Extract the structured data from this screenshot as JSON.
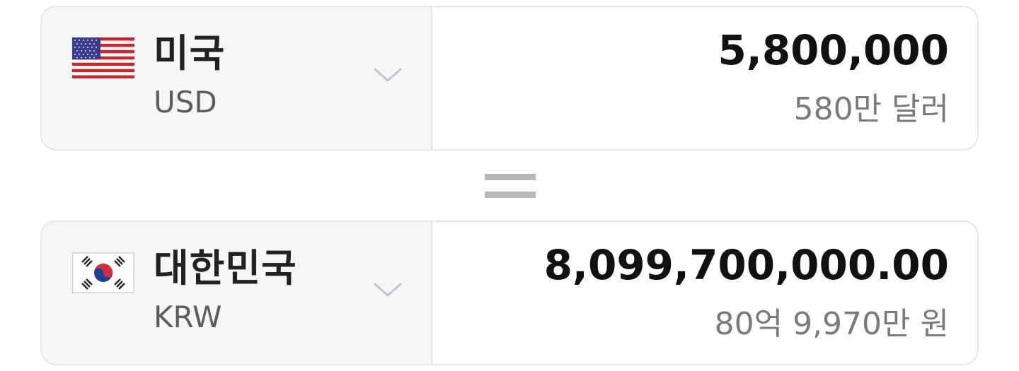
{
  "from_currency": {
    "country": "미국",
    "code": "USD",
    "flag_icon": "us-flag-icon",
    "amount": "5,800,000",
    "amount_words": "580만 달러"
  },
  "to_currency": {
    "country": "대한민국",
    "code": "KRW",
    "flag_icon": "kr-flag-icon",
    "amount": "8,099,700,000.00",
    "amount_words": "80억 9,970만 원"
  },
  "equals_icon": "equals-icon",
  "dropdown_icon": "chevron-down-icon",
  "colors": {
    "panel_bg": "#f6f6f8",
    "border": "#e6e6e8",
    "amount_text": "#111111",
    "sub_text": "#7a7a7a",
    "equals": "#b8b8b8"
  }
}
